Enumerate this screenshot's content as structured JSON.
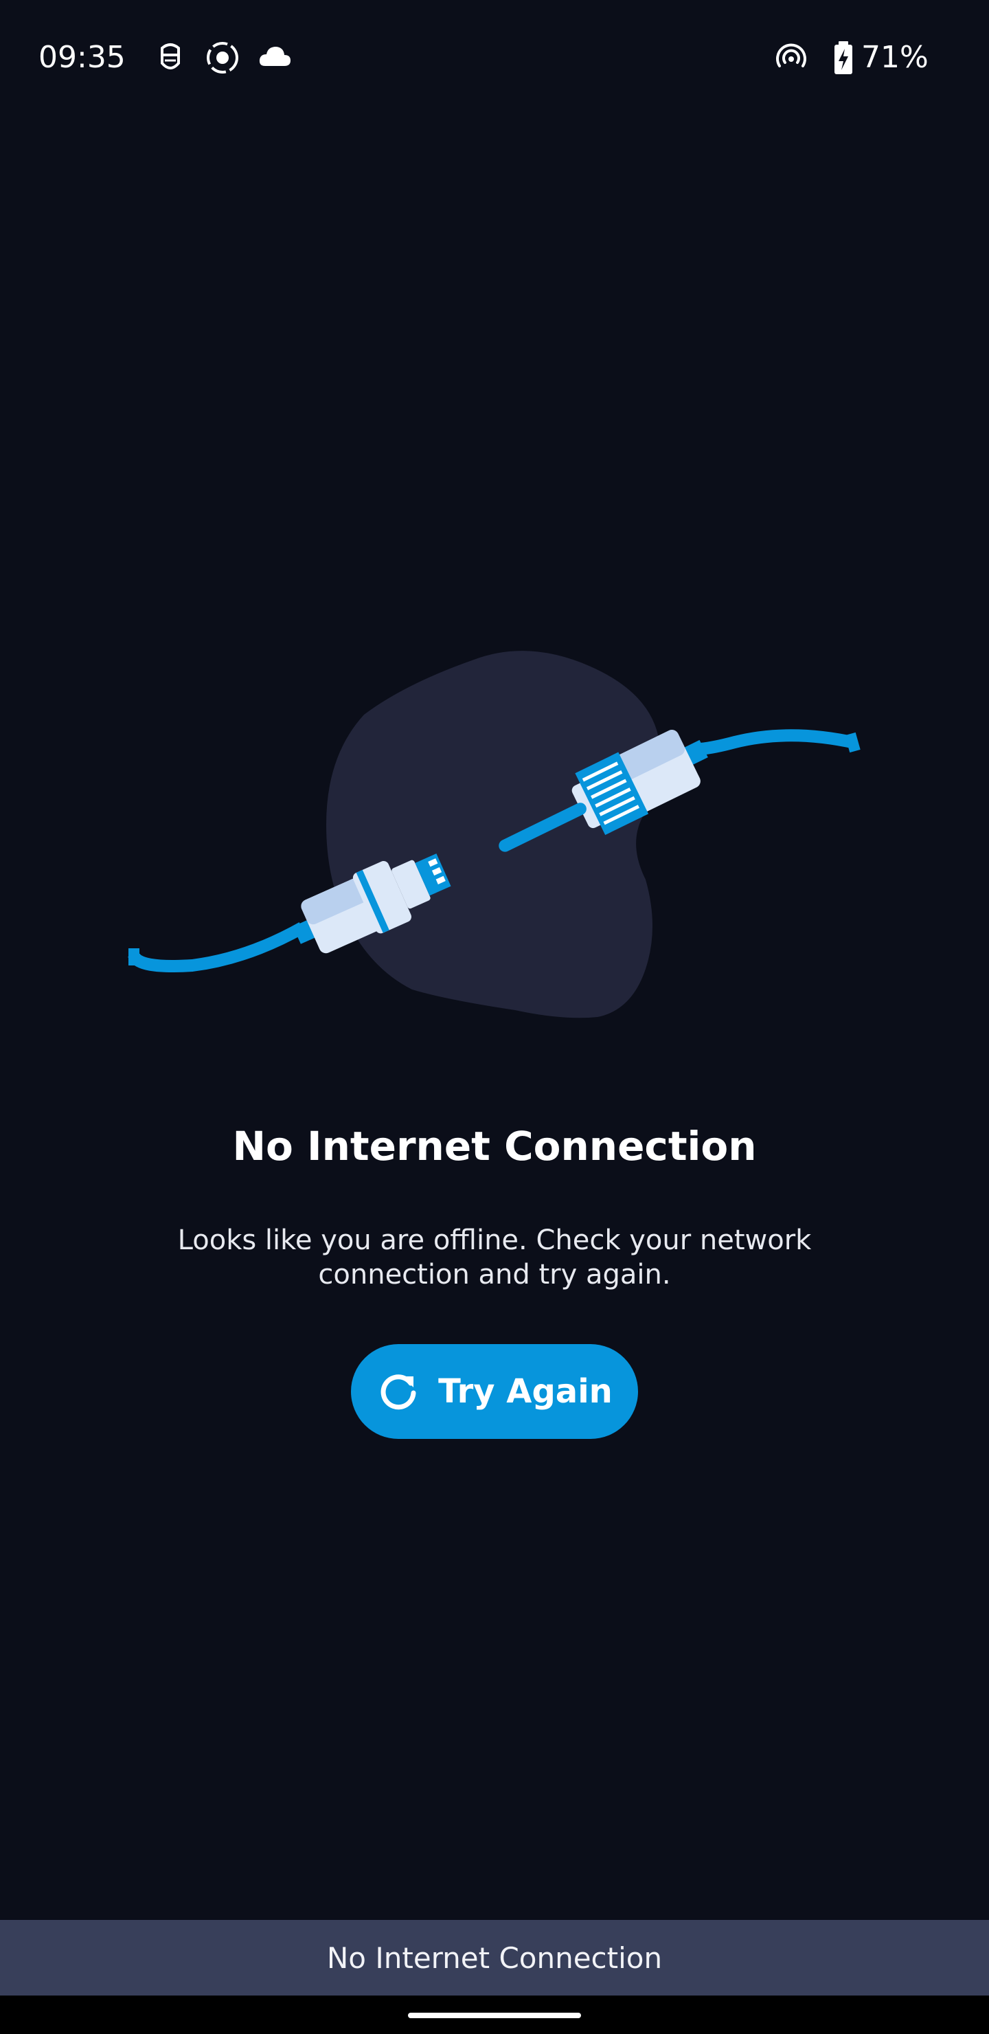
{
  "status_bar": {
    "time": "09:35",
    "battery_percent": "71%",
    "icons": [
      "face-mask-icon",
      "screen-record-icon",
      "cloud-icon",
      "hotspot-icon",
      "battery-charging-icon"
    ]
  },
  "error": {
    "title": "No Internet Connection",
    "message": "Looks like you are offline. Check your network connection and try again.",
    "illustration": "unplugged-cable-illustration"
  },
  "actions": {
    "try_again_label": "Try Again",
    "try_again_icon": "refresh-icon"
  },
  "snackbar": {
    "text": "No Internet Connection"
  },
  "colors": {
    "background": "#0b0e19",
    "accent": "#0795dc",
    "blob": "#22253a",
    "plug_light": "#dce8f8",
    "plug_mid": "#b9d0ee",
    "snackbar": "#383f5a"
  }
}
